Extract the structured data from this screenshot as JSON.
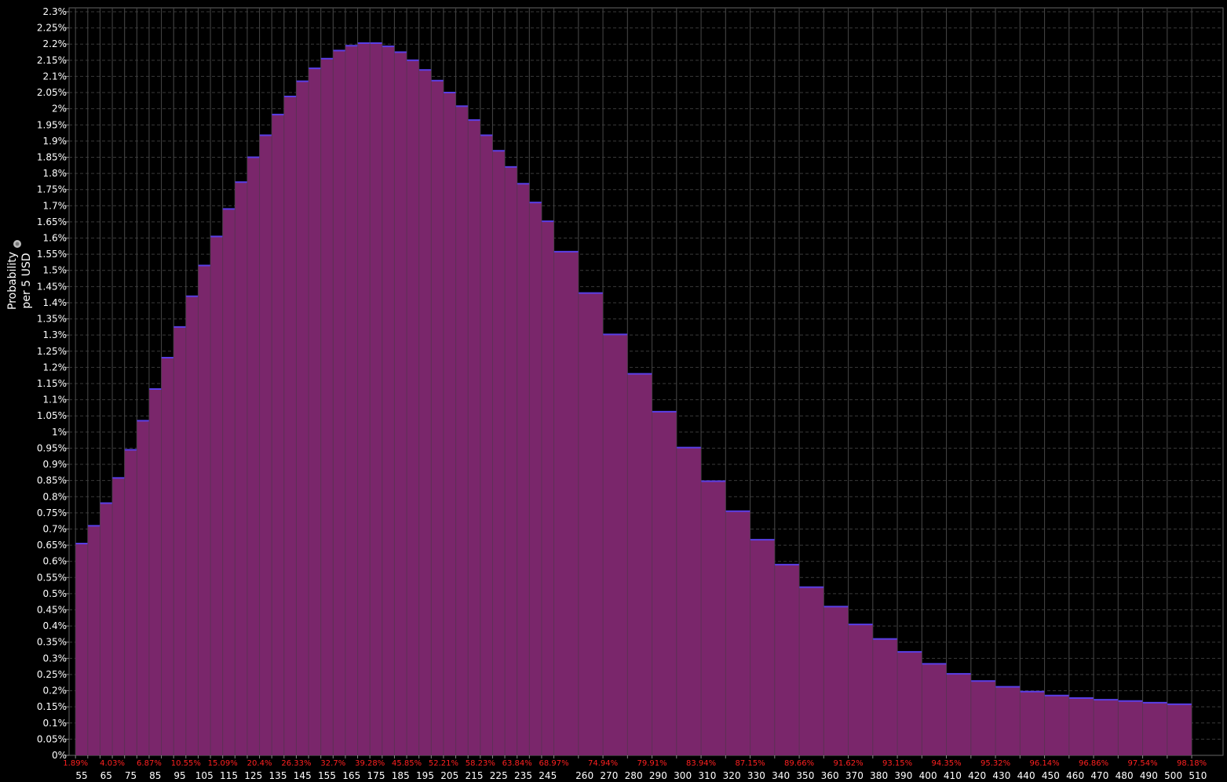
{
  "chart_data": {
    "type": "bar",
    "ylabel_line1": "Probability",
    "ylabel_line2": "per 5 USD",
    "ylim": [
      0,
      2.3
    ],
    "y_tick_step": 0.05,
    "y_unit": "%",
    "grid": true,
    "colors": {
      "background": "#000000",
      "bar_fill": "#7a266b",
      "bar_top": "#5a3fe6",
      "grid": "#555555",
      "axis_text": "#ffffff",
      "cumulative_text": "#ff2020"
    },
    "bins": [
      [
        50,
        60,
        0.655
      ],
      [
        60,
        70,
        0.71
      ],
      [
        70,
        80,
        0.78
      ],
      [
        80,
        90,
        0.858
      ],
      [
        90,
        100,
        0.945
      ],
      [
        100,
        110,
        1.035
      ],
      [
        110,
        120,
        1.133
      ],
      [
        120,
        130,
        1.23
      ],
      [
        130,
        140,
        1.325
      ],
      [
        140,
        150,
        1.42
      ],
      [
        150,
        160,
        1.515
      ],
      [
        160,
        170,
        1.605
      ],
      [
        170,
        180,
        1.69
      ],
      [
        180,
        190,
        1.773
      ],
      [
        190,
        200,
        1.85
      ],
      [
        200,
        210,
        1.918
      ],
      [
        210,
        220,
        1.982
      ],
      [
        220,
        230,
        2.038
      ],
      [
        230,
        240,
        2.085
      ],
      [
        240,
        250,
        2.125
      ],
      [
        250,
        260,
        2.155
      ],
      [
        260,
        270,
        2.18
      ],
      [
        270,
        280,
        2.195
      ],
      [
        280,
        290,
        2.203
      ],
      [
        290,
        300,
        2.203
      ],
      [
        300,
        310,
        2.193
      ],
      [
        310,
        320,
        2.175
      ],
      [
        320,
        330,
        2.15
      ],
      [
        330,
        340,
        2.12
      ],
      [
        340,
        350,
        2.087
      ],
      [
        350,
        360,
        2.05
      ],
      [
        360,
        370,
        2.008
      ],
      [
        370,
        380,
        1.965
      ],
      [
        380,
        390,
        1.918
      ],
      [
        390,
        400,
        1.87
      ],
      [
        400,
        410,
        1.82
      ],
      [
        410,
        420,
        1.768
      ],
      [
        420,
        430,
        1.71
      ],
      [
        430,
        440,
        1.652
      ],
      [
        440,
        460,
        1.558
      ],
      [
        460,
        480,
        1.43
      ],
      [
        480,
        500,
        1.302
      ],
      [
        500,
        520,
        1.18
      ],
      [
        520,
        540,
        1.063
      ],
      [
        540,
        560,
        0.952
      ],
      [
        560,
        580,
        0.848
      ],
      [
        580,
        600,
        0.755
      ],
      [
        600,
        620,
        0.667
      ],
      [
        620,
        640,
        0.59
      ],
      [
        640,
        660,
        0.52
      ],
      [
        660,
        680,
        0.46
      ],
      [
        680,
        700,
        0.405
      ],
      [
        700,
        720,
        0.36
      ],
      [
        720,
        740,
        0.32
      ],
      [
        740,
        760,
        0.283
      ],
      [
        760,
        780,
        0.252
      ],
      [
        780,
        800,
        0.23
      ],
      [
        800,
        820,
        0.212
      ],
      [
        820,
        840,
        0.197
      ],
      [
        840,
        860,
        0.185
      ],
      [
        860,
        880,
        0.177
      ],
      [
        880,
        900,
        0.172
      ],
      [
        900,
        920,
        0.168
      ],
      [
        920,
        940,
        0.163
      ],
      [
        940,
        960,
        0.158
      ]
    ],
    "x_tick_labels": [
      {
        "x": 55,
        "label": "55"
      },
      {
        "x": 75,
        "label": "65"
      },
      {
        "x": 95,
        "label": "75"
      },
      {
        "x": 115,
        "label": "85"
      },
      {
        "x": 135,
        "label": "95"
      },
      {
        "x": 155,
        "label": "105"
      },
      {
        "x": 175,
        "label": "115"
      },
      {
        "x": 195,
        "label": "125"
      },
      {
        "x": 215,
        "label": "135"
      },
      {
        "x": 235,
        "label": "145"
      },
      {
        "x": 255,
        "label": "155"
      },
      {
        "x": 275,
        "label": "165"
      },
      {
        "x": 295,
        "label": "175"
      },
      {
        "x": 315,
        "label": "185"
      },
      {
        "x": 335,
        "label": "195"
      },
      {
        "x": 355,
        "label": "205"
      },
      {
        "x": 375,
        "label": "215"
      },
      {
        "x": 395,
        "label": "225"
      },
      {
        "x": 415,
        "label": "235"
      },
      {
        "x": 435,
        "label": "245"
      },
      {
        "x": 465,
        "label": "260"
      },
      {
        "x": 485,
        "label": "270"
      },
      {
        "x": 505,
        "label": "280"
      },
      {
        "x": 525,
        "label": "290"
      },
      {
        "x": 545,
        "label": "300"
      },
      {
        "x": 565,
        "label": "310"
      },
      {
        "x": 585,
        "label": "320"
      },
      {
        "x": 605,
        "label": "330"
      },
      {
        "x": 625,
        "label": "340"
      },
      {
        "x": 645,
        "label": "350"
      },
      {
        "x": 665,
        "label": "360"
      },
      {
        "x": 685,
        "label": "370"
      },
      {
        "x": 705,
        "label": "380"
      },
      {
        "x": 725,
        "label": "390"
      },
      {
        "x": 745,
        "label": "400"
      },
      {
        "x": 765,
        "label": "410"
      },
      {
        "x": 785,
        "label": "420"
      },
      {
        "x": 805,
        "label": "430"
      },
      {
        "x": 825,
        "label": "440"
      },
      {
        "x": 845,
        "label": "450"
      },
      {
        "x": 865,
        "label": "460"
      },
      {
        "x": 885,
        "label": "470"
      },
      {
        "x": 905,
        "label": "480"
      },
      {
        "x": 925,
        "label": "490"
      },
      {
        "x": 945,
        "label": "500"
      },
      {
        "x": 965,
        "label": "510"
      }
    ],
    "cumulative_labels": [
      {
        "x": 50,
        "label": "1.89%"
      },
      {
        "x": 80,
        "label": "4.03%"
      },
      {
        "x": 110,
        "label": "6.87%"
      },
      {
        "x": 140,
        "label": "10.55%"
      },
      {
        "x": 170,
        "label": "15.09%"
      },
      {
        "x": 200,
        "label": "20.4%"
      },
      {
        "x": 230,
        "label": "26.33%"
      },
      {
        "x": 260,
        "label": "32.7%"
      },
      {
        "x": 290,
        "label": "39.28%"
      },
      {
        "x": 320,
        "label": "45.85%"
      },
      {
        "x": 350,
        "label": "52.21%"
      },
      {
        "x": 380,
        "label": "58.23%"
      },
      {
        "x": 410,
        "label": "63.84%"
      },
      {
        "x": 440,
        "label": "68.97%"
      },
      {
        "x": 480,
        "label": "74.94%"
      },
      {
        "x": 520,
        "label": "79.91%"
      },
      {
        "x": 560,
        "label": "83.94%"
      },
      {
        "x": 600,
        "label": "87.15%"
      },
      {
        "x": 640,
        "label": "89.66%"
      },
      {
        "x": 680,
        "label": "91.62%"
      },
      {
        "x": 720,
        "label": "93.15%"
      },
      {
        "x": 760,
        "label": "94.35%"
      },
      {
        "x": 800,
        "label": "95.32%"
      },
      {
        "x": 840,
        "label": "96.14%"
      },
      {
        "x": 880,
        "label": "96.86%"
      },
      {
        "x": 920,
        "label": "97.54%"
      },
      {
        "x": 960,
        "label": "98.18%"
      }
    ]
  }
}
